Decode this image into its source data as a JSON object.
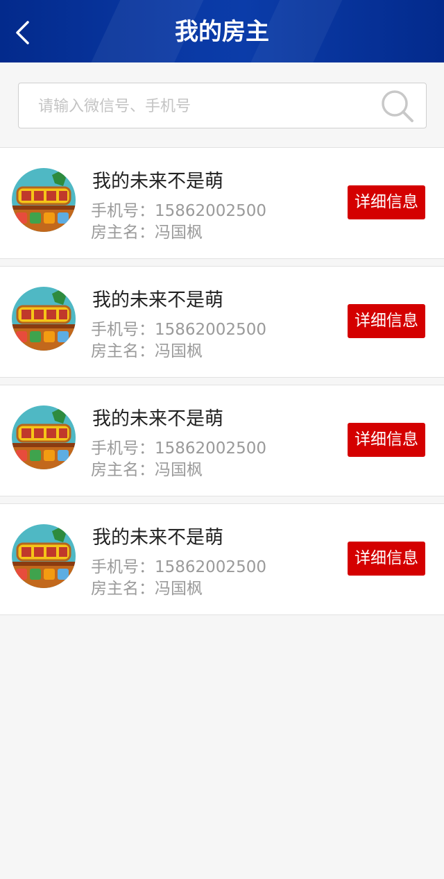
{
  "header": {
    "title": "我的房主",
    "back_icon": "chevron-left-icon"
  },
  "search": {
    "placeholder": "请输入微信号、手机号",
    "value": "",
    "icon": "search-icon"
  },
  "colors": {
    "header_bg": "#0a3aa6",
    "button_bg": "#d40000",
    "page_bg": "#f6f6f6"
  },
  "landlords": [
    {
      "name": "我的未来不是萌",
      "phone": "手机号：15862002500",
      "owner": "房主名：冯国枫",
      "button": "详细信息"
    },
    {
      "name": "我的未来不是萌",
      "phone": "手机号：15862002500",
      "owner": "房主名：冯国枫",
      "button": "详细信息"
    },
    {
      "name": "我的未来不是萌",
      "phone": "手机号：15862002500",
      "owner": "房主名：冯国枫",
      "button": "详细信息"
    },
    {
      "name": "我的未来不是萌",
      "phone": "手机号：15862002500",
      "owner": "房主名：冯国枫",
      "button": "详细信息"
    }
  ]
}
